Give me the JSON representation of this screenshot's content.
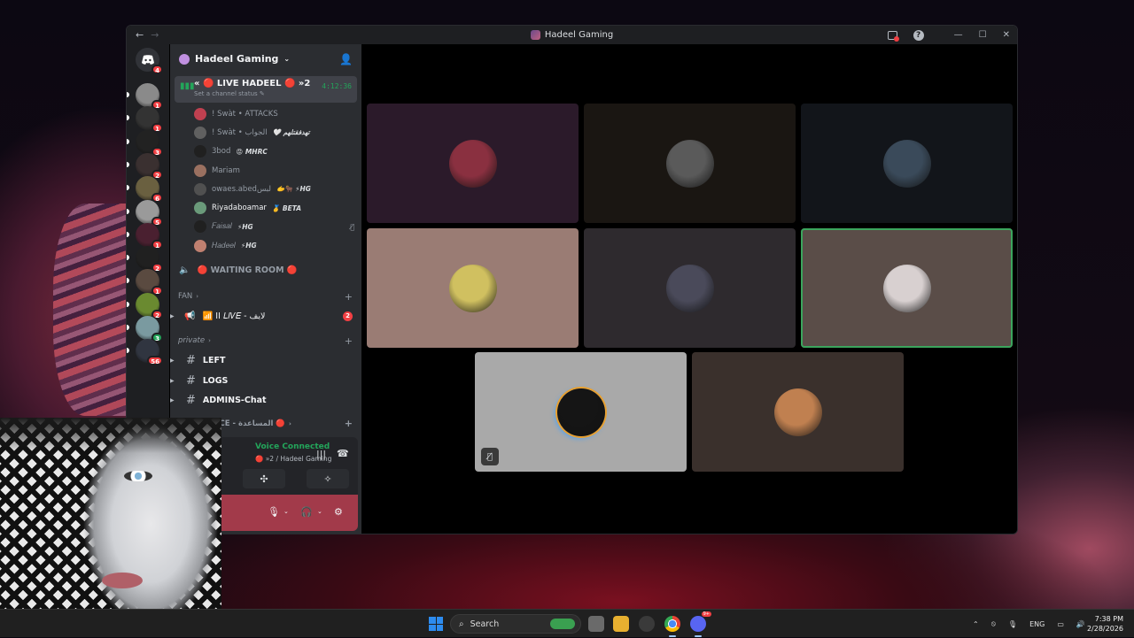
{
  "window": {
    "title": "Hadeel Gaming",
    "back": "←",
    "forward": "→",
    "help": "?",
    "minimize": "—",
    "maximize": "☐",
    "close": "✕"
  },
  "rail": {
    "home_badge": "4",
    "servers": [
      {
        "badge": "1",
        "color": "#8a8a8a"
      },
      {
        "badge": "1",
        "color": "#333"
      },
      {
        "badge": "3",
        "color": "#222"
      },
      {
        "badge": "2",
        "color": "#3a3030"
      },
      {
        "badge": "6",
        "color": "#6a6040"
      },
      {
        "badge": "5",
        "color": "#9a9a9a"
      },
      {
        "badge": "1",
        "color": "#4a2030"
      },
      {
        "badge": "2",
        "color": "#202020"
      },
      {
        "badge": "1",
        "color": "#5a4a40"
      },
      {
        "badge": "2",
        "color": "#6a8a30"
      },
      {
        "badge": "3",
        "color": "#7a9aa0"
      },
      {
        "badge": "56",
        "color": "#303540"
      }
    ]
  },
  "sidebar": {
    "server_name": "Hadeel Gaming",
    "active_channel": {
      "name": "« 🔴 LIVE HADEEL 🔴 »2",
      "status": "Set a channel status",
      "timer": "4:12:36"
    },
    "members": [
      {
        "name": "! Swàt • ATTACKS",
        "tag": "",
        "color": "#c04050",
        "bright": false
      },
      {
        "name": "! Swàt • الجواب",
        "tag": "🤍 تهدفقتلهم",
        "color": "#606060",
        "bright": false
      },
      {
        "name": "3bod",
        "tag": "😡 MHRC",
        "color": "#202020",
        "bright": false
      },
      {
        "name": "Mariam",
        "tag": "",
        "color": "#9a7060",
        "bright": false
      },
      {
        "name": "owaes.abedﻟﺒﺲ",
        "tag": "🫱🐂 ⚡HG",
        "color": "#505050",
        "bright": false
      },
      {
        "name": "Riyadaboamar",
        "tag": "🥇 BETA",
        "color": "#6a9a7a",
        "bright": true
      },
      {
        "name": "𝐹𝑎𝑖𝑠𝑎𝑙",
        "tag": "⚡HG",
        "color": "#202020",
        "bright": false,
        "muted": true
      },
      {
        "name": "𝐻𝑎𝑑𝑒𝑒𝑙",
        "tag": "⚡HG",
        "color": "#c08070",
        "bright": false
      }
    ],
    "waiting_room": "🔴 WAITING ROOM 🔴",
    "cat_fan": "FAN",
    "fan_channel": "📶 II 𝐿𝐼𝑉𝐸 - لايف",
    "fan_badge": "2",
    "cat_private": "private",
    "text_channels": [
      "LEFT",
      "LOGS",
      "ADMINS-Chat"
    ],
    "cat_assistance": "ASSISTANCE - المساعدة 🔴"
  },
  "voice_panel": {
    "connected": "Voice Connected",
    "location": "🔴 »2 / Hadeel Gaming"
  },
  "tiles": [
    {
      "bg": "#2b1a2a",
      "avatar": "#8a3040",
      "speaking": false,
      "muted": false
    },
    {
      "bg": "#1a1612",
      "avatar": "#5a5a5a",
      "speaking": false,
      "muted": false
    },
    {
      "bg": "#12151a",
      "avatar": "#3a4a5a",
      "speaking": false,
      "muted": false
    },
    {
      "bg": "#9a7c74",
      "avatar": "#d0c060",
      "speaking": false,
      "muted": false
    },
    {
      "bg": "#2e2a2e",
      "avatar": "#4a4a5a",
      "speaking": false,
      "muted": false
    },
    {
      "bg": "#5a4d48",
      "avatar": "#d8d0d0",
      "speaking": true,
      "muted": false
    },
    {
      "bg": "#a9a9a9",
      "avatar": "#151515",
      "speaking": false,
      "muted": true
    },
    {
      "bg": "#3a302c",
      "avatar": "#c08050",
      "speaking": false,
      "muted": false
    }
  ],
  "taskbar": {
    "search_placeholder": "Search",
    "lang": "ENG",
    "time": "7:38 PM",
    "date": "2/28/2026",
    "chat_badge": "9+"
  }
}
